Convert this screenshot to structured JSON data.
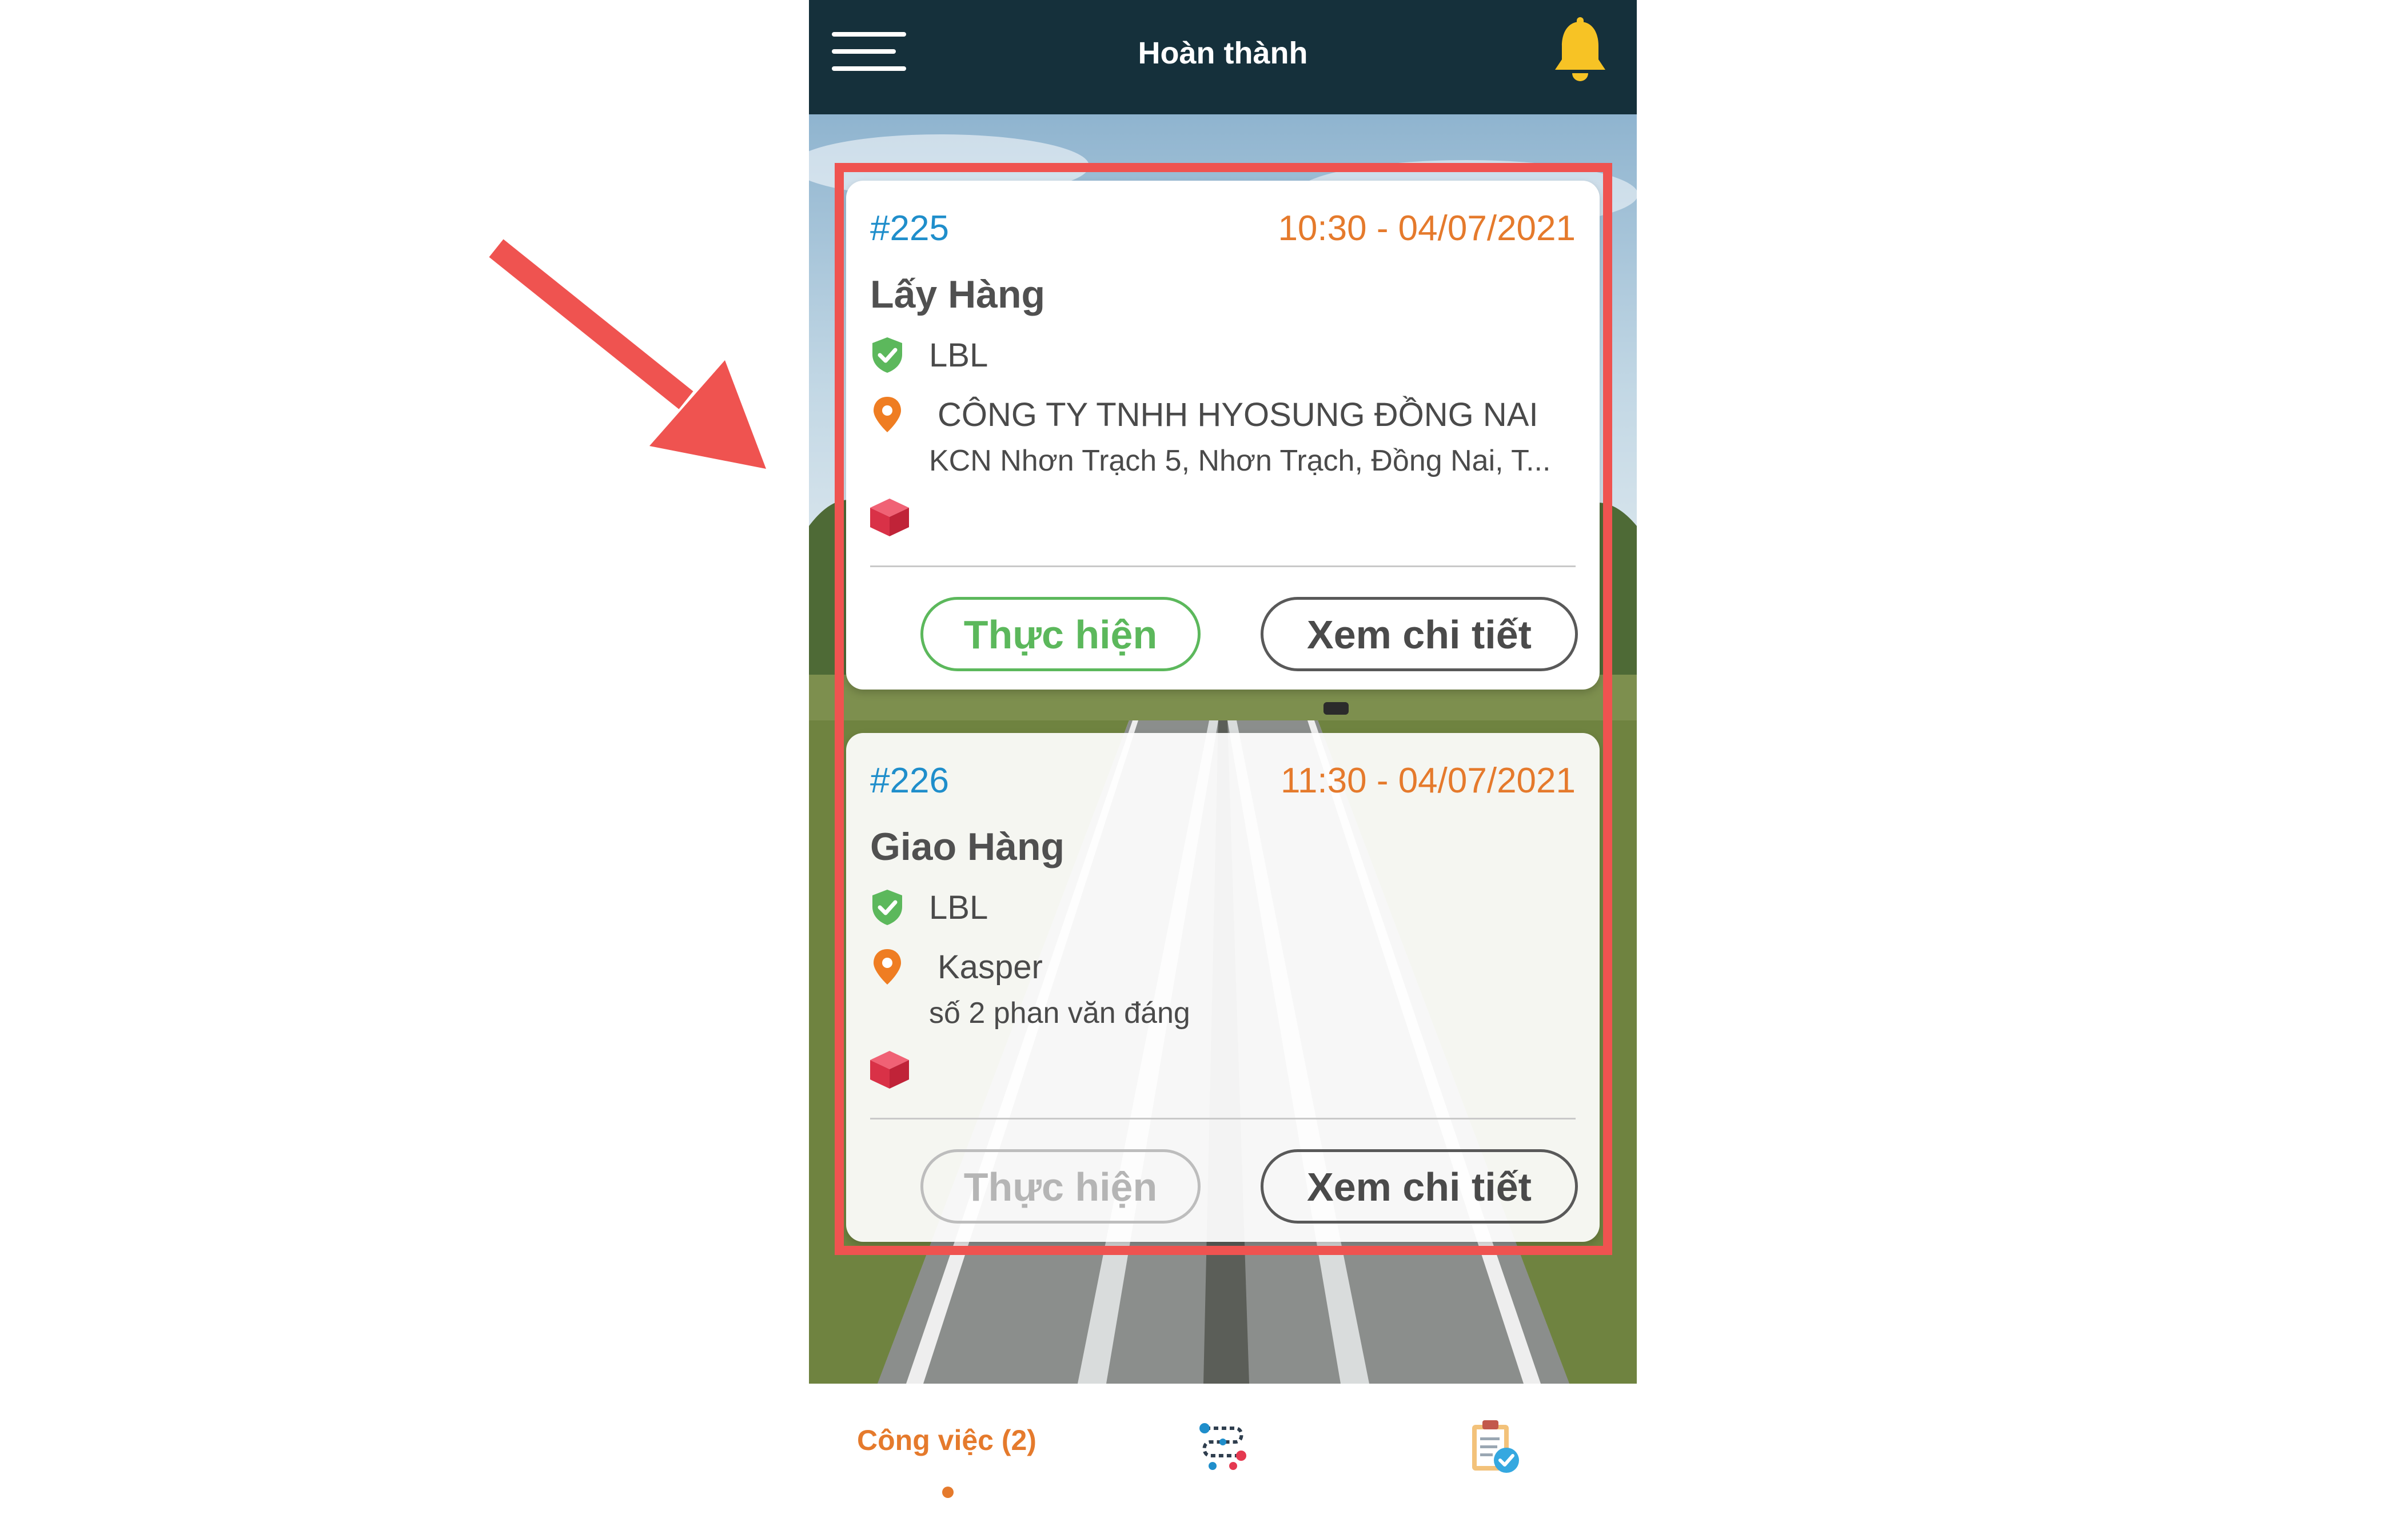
{
  "header": {
    "title": "Hoàn thành",
    "menu_icon": "hamburger-menu-icon",
    "bell_icon": "bell-icon",
    "bar_color": "#15303b",
    "bell_color": "#f7c325"
  },
  "jobs": [
    {
      "id": "#225",
      "time": "10:30 - 04/07/2021",
      "type": "Lấy Hàng",
      "customer": "LBL",
      "location_name": "CÔNG TY TNHH HYOSUNG ĐỒNG NAI",
      "address": "KCN Nhơn Trạch 5, Nhơn Trạch, Đồng Nai, T...",
      "execute_label": "Thực hiện",
      "execute_enabled": true,
      "detail_label": "Xem chi tiết"
    },
    {
      "id": "#226",
      "time": "11:30 - 04/07/2021",
      "type": "Giao Hàng",
      "customer": "LBL",
      "location_name": "Kasper",
      "address": "số 2 phan văn đáng",
      "execute_label": "Thực hiện",
      "execute_enabled": false,
      "detail_label": "Xem chi tiết"
    }
  ],
  "bottom_nav": {
    "jobs_label": "Công việc (2)",
    "route_icon": "route-icon",
    "report_icon": "clipboard-check-icon"
  },
  "colors": {
    "id_blue": "#1f8ecb",
    "time_orange": "#e57a2c",
    "shield_green": "#5cb85c",
    "pin_orange": "#ef7d22",
    "box_red": "#e53950",
    "annotation_red": "#ef5350"
  }
}
